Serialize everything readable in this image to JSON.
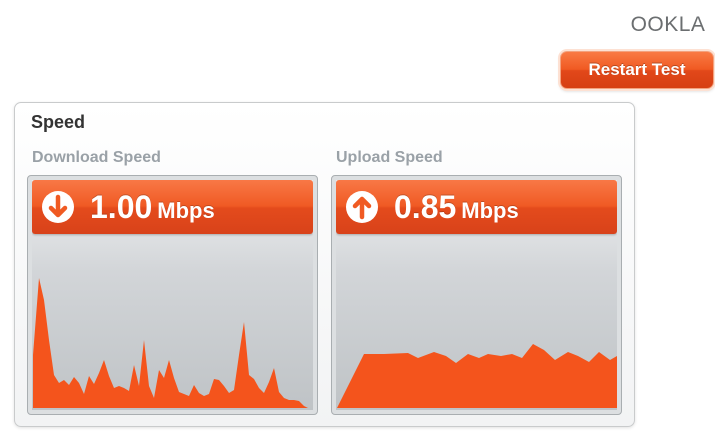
{
  "brand": {
    "logo_text": "OOKLA"
  },
  "actions": {
    "restart_label": "Restart Test"
  },
  "panel": {
    "title": "Speed"
  },
  "download": {
    "label": "Download Speed",
    "value": "1.00",
    "unit": "Mbps",
    "icon": "arrow-down-icon",
    "color": "#f05a22"
  },
  "upload": {
    "label": "Upload Speed",
    "value": "0.85",
    "unit": "Mbps",
    "icon": "arrow-up-icon",
    "color": "#f05a22"
  }
}
